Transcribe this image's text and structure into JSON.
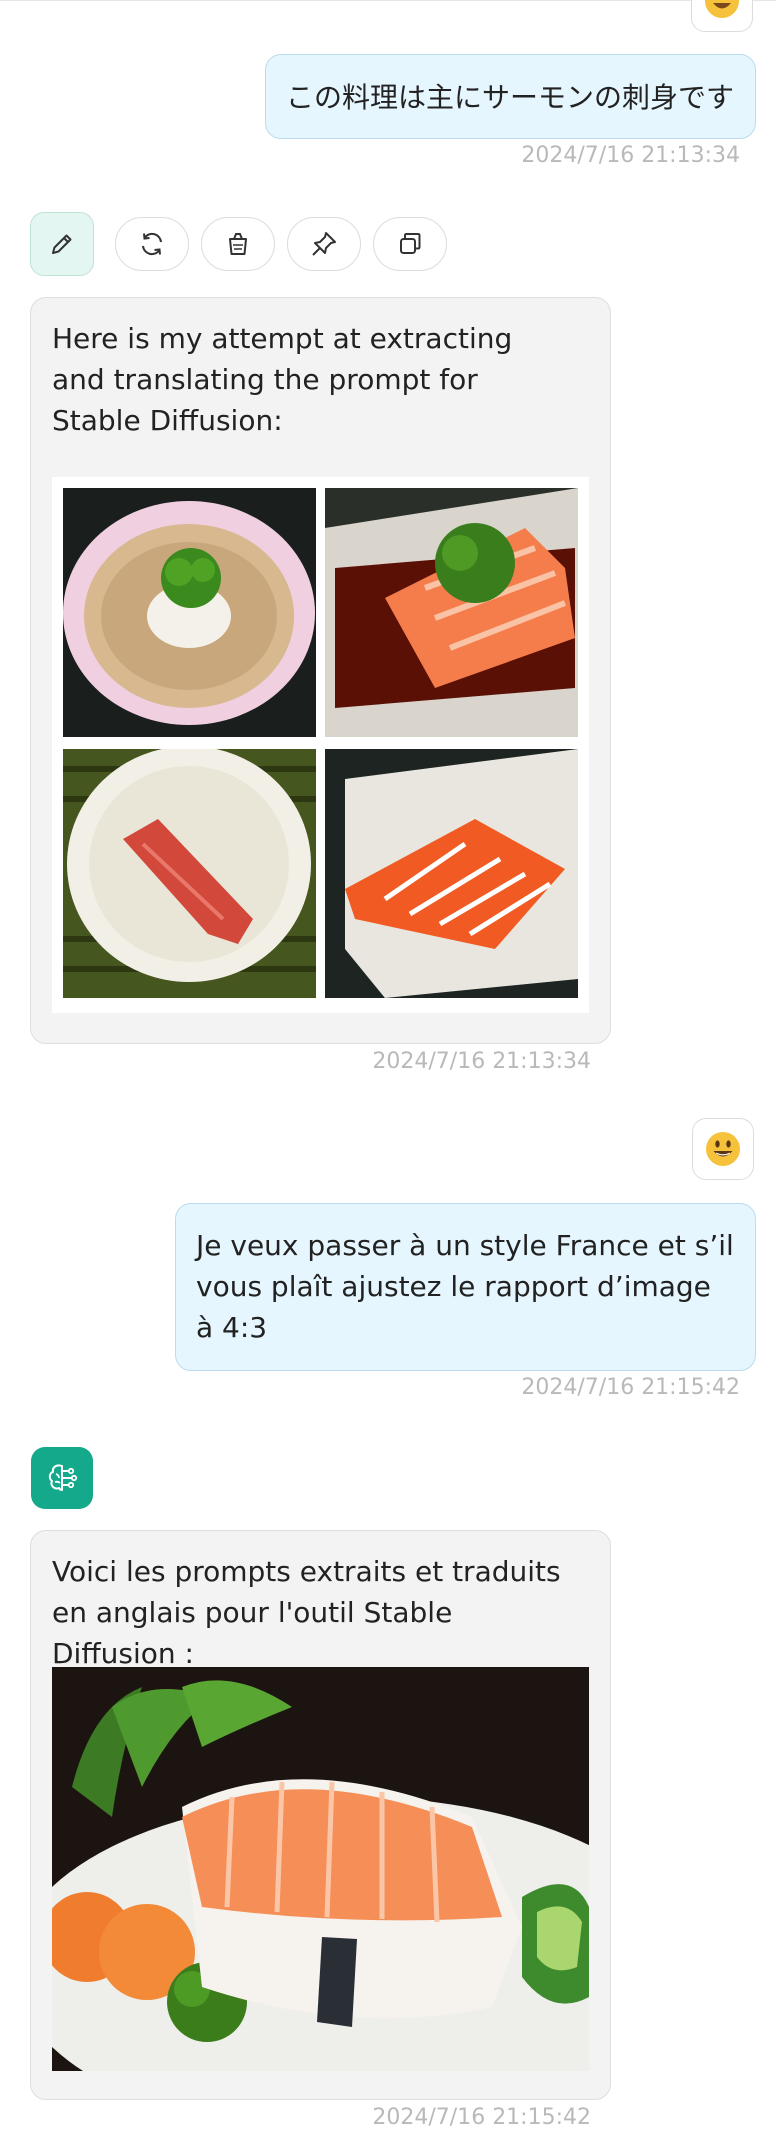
{
  "colors": {
    "user_bubble_bg": "#e6f6fe",
    "bot_bubble_bg": "#f3f3f3",
    "accent": "#13a98a",
    "timestamp": "#b9b9b9"
  },
  "messages": [
    {
      "role": "user",
      "text": "この料理は主にサーモンの刺身です",
      "timestamp": "2024/7/16 21:13:34",
      "avatar_icon": "smiley-emoji-icon"
    },
    {
      "role": "assistant",
      "text": "Here is my attempt at extracting and translating the prompt for Stable Diffusion:",
      "timestamp": "2024/7/16 21:13:34",
      "image": "salmon-sushi-2x2-grid"
    },
    {
      "role": "user",
      "text": "Je veux passer à un style France et s’il vous plaît ajustez le rapport d’image à 4:3",
      "timestamp": "2024/7/16 21:15:42",
      "avatar_icon": "smiley-emoji-icon"
    },
    {
      "role": "assistant",
      "text": "Voici les prompts extraits et traduits en anglais pour l'outil Stable Diffusion :",
      "timestamp": "2024/7/16 21:15:42",
      "image": "salmon-sashimi-plate",
      "avatar_icon": "brain-circuit-icon"
    }
  ],
  "message_actions": [
    "edit-icon",
    "refresh-icon",
    "delete-icon",
    "pin-icon",
    "copy-icon"
  ]
}
